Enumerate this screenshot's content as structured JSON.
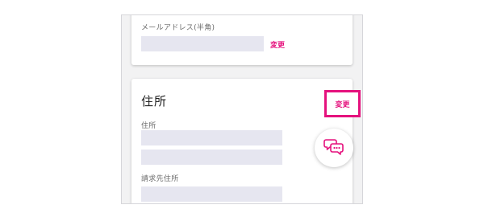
{
  "email_section": {
    "label": "メールアドレス(半角)",
    "change_label": "変更"
  },
  "address_section": {
    "title": "住所",
    "change_label": "変更",
    "address_label": "住所",
    "billing_label": "請求先住所"
  },
  "chat_button": {
    "icon": "chat-bubbles-icon"
  },
  "colors": {
    "accent": "#e5117d",
    "placeholder_bar": "#e6e6f0",
    "background": "#f2f2f3"
  }
}
